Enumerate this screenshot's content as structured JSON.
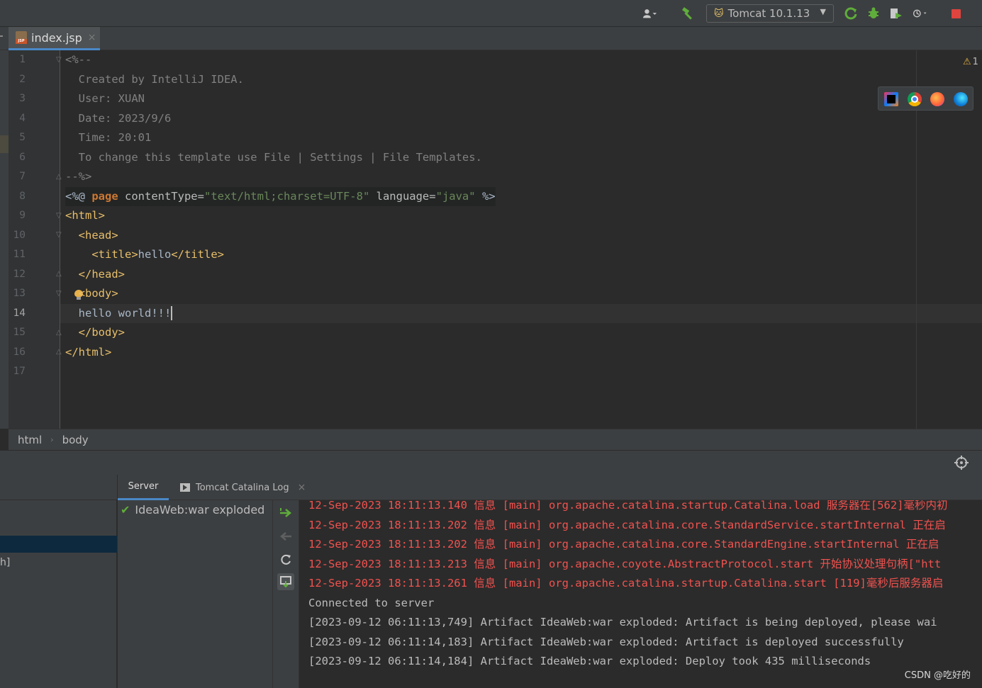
{
  "toolbar": {
    "run_config": "Tomcat 10.1.13",
    "icons": [
      "user-icon",
      "build-hammer-icon",
      "rerun-icon",
      "debug-icon",
      "coverage-icon",
      "profiler-icon",
      "stop-icon"
    ]
  },
  "tabs": [
    {
      "label": "index.jsp",
      "icon": "jsp-file-icon",
      "active": true
    }
  ],
  "editor": {
    "line_numbers": [
      "1",
      "2",
      "3",
      "4",
      "5",
      "6",
      "7",
      "8",
      "9",
      "10",
      "11",
      "12",
      "13",
      "14",
      "15",
      "16",
      "17"
    ],
    "current_line": "14",
    "lines": {
      "l1": "<%--",
      "l2": "  Created by IntelliJ IDEA.",
      "l3": "  User: XUAN",
      "l4": "  Date: 2023/9/6",
      "l5": "  Time: 20:01",
      "l6": "  To change this template use File | Settings | File Templates.",
      "l7": "--%>",
      "l8_open": "<%@ ",
      "l8_page": "page",
      "l8_attr1": " contentType=",
      "l8_val1": "\"text/html;charset=UTF-8\"",
      "l8_attr2": " language=",
      "l8_val2": "\"java\"",
      "l8_close": " %>",
      "l9": "<html>",
      "l10": "  <head>",
      "l11_open": "    <title>",
      "l11_text": "hello",
      "l11_close": "</title>",
      "l12": "  </head>",
      "l13": "  <body>",
      "l14": "  hello world!!!",
      "l15": "  </body>",
      "l16": "</html>"
    },
    "warning_count": "1",
    "browsers": [
      "intellij-icon",
      "chrome-icon",
      "firefox-icon",
      "edge-icon"
    ]
  },
  "breadcrumb": [
    "html",
    "body"
  ],
  "services": {
    "left_partial_text": "h]",
    "tabs": {
      "server": "Server",
      "catalina": "Tomcat Catalina Log"
    },
    "deployment": "IdeaWeb:war exploded",
    "log_lines": [
      {
        "text": "12-Sep-2023 18:11:13.140 信息 [main] org.apache.catalina.startup.Catalina.load 服务器在[562]毫秒内初",
        "level": "info"
      },
      {
        "text": "12-Sep-2023 18:11:13.202 信息 [main] org.apache.catalina.core.StandardService.startInternal 正在启",
        "level": "info"
      },
      {
        "text": "12-Sep-2023 18:11:13.202 信息 [main] org.apache.catalina.core.StandardEngine.startInternal 正在启",
        "level": "info"
      },
      {
        "text": "12-Sep-2023 18:11:13.213 信息 [main] org.apache.coyote.AbstractProtocol.start 开始协议处理句柄[\"htt",
        "level": "info"
      },
      {
        "text": "12-Sep-2023 18:11:13.261 信息 [main] org.apache.catalina.startup.Catalina.start [119]毫秒后服务器启",
        "level": "info"
      },
      {
        "text": "Connected to server",
        "level": "normal"
      },
      {
        "text": "[2023-09-12 06:11:13,749] Artifact IdeaWeb:war exploded: Artifact is being deployed, please wai",
        "level": "normal"
      },
      {
        "text": "[2023-09-12 06:11:14,183] Artifact IdeaWeb:war exploded: Artifact is deployed successfully",
        "level": "normal"
      },
      {
        "text": "[2023-09-12 06:11:14,184] Artifact IdeaWeb:war exploded: Deploy took 435 milliseconds",
        "level": "normal"
      }
    ]
  },
  "watermark": "CSDN @吃好的",
  "colors": {
    "accent": "#4a88c7",
    "log_red": "#f0524f",
    "tag": "#e8bf6a",
    "keyword": "#cc7832",
    "string": "#6a8759",
    "comment": "#808080",
    "success": "#5fad3b"
  }
}
